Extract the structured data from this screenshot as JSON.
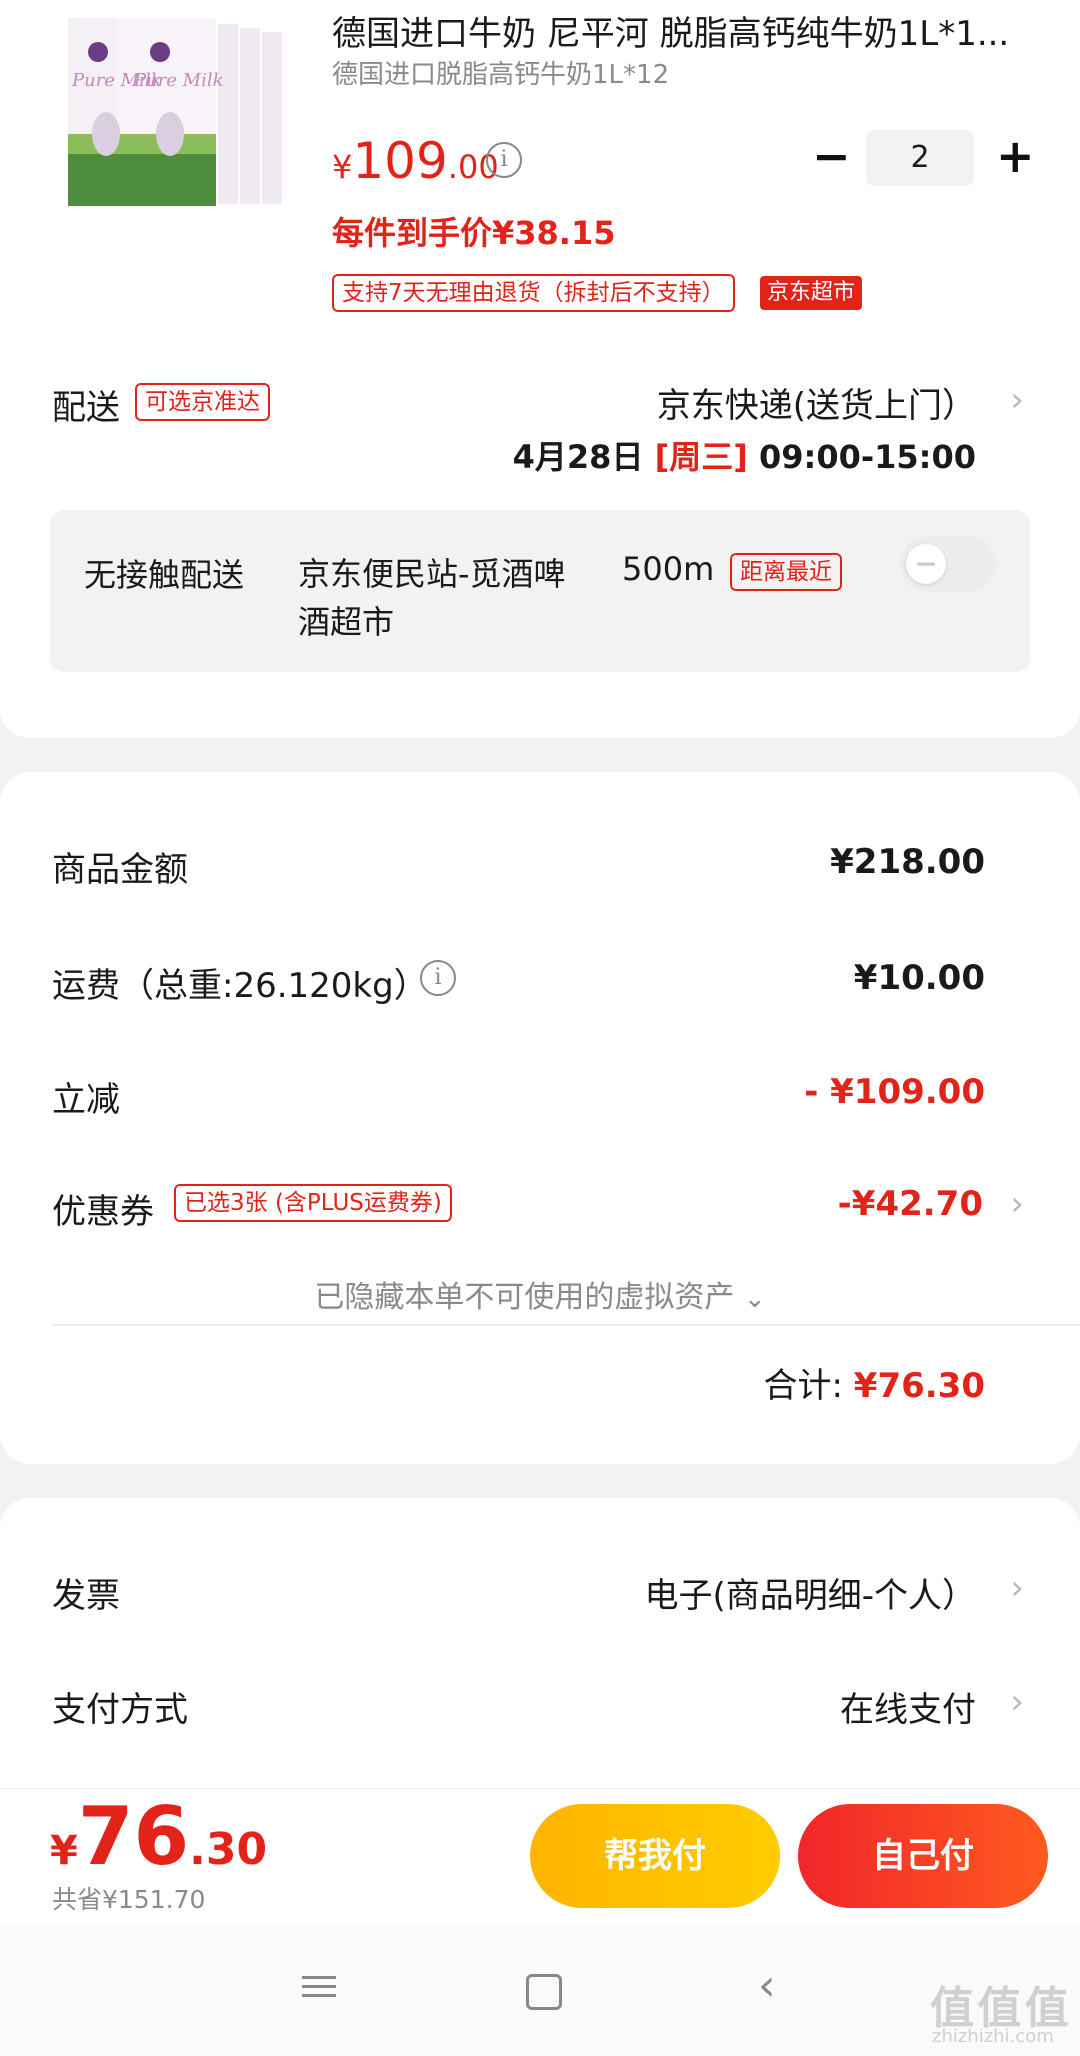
{
  "product": {
    "image_label": "Pure Milk",
    "title": "德国进口牛奶 尼平河 脱脂高钙纯牛奶1L*1...",
    "subtitle": "德国进口脱脂高钙牛奶1L*12",
    "price_symbol": "¥",
    "price_int": "109",
    "price_dec": ".00",
    "quantity": "2",
    "minus": "−",
    "plus": "+",
    "unit_price": "每件到手价¥38.15",
    "return_policy": "支持7天无理由退货（拆封后不支持）",
    "store_badge": "京东超市"
  },
  "delivery": {
    "label": "配送",
    "tag": "可选京准达",
    "method": "京东快递(送货上门）",
    "date": "4月28日",
    "weekday": "[周三]",
    "time": "09:00-15:00",
    "contactless_label": "无接触配送",
    "station": "京东便民站-觅酒啤酒超市",
    "distance": "500m",
    "distance_tag": "距离最近"
  },
  "summary": {
    "goods_label": "商品金额",
    "goods_value": "¥218.00",
    "shipping_label": "运费（总重:26.120kg）",
    "shipping_value": "¥10.00",
    "discount_label": "立减",
    "discount_value": "- ¥109.00",
    "coupon_label": "优惠券",
    "coupon_tag": "已选3张 (含PLUS运费券)",
    "coupon_value": "-¥42.70",
    "hidden_assets": "已隐藏本单不可使用的虚拟资产",
    "total_label": "合计:",
    "total_value": "¥76.30"
  },
  "options": {
    "invoice_label": "发票",
    "invoice_value": "电子(商品明细-个人）",
    "payment_label": "支付方式",
    "payment_value": "在线支付"
  },
  "checkout": {
    "symbol": "¥",
    "amount_int": "76",
    "amount_dec": ".30",
    "saved": "共省¥151.70",
    "help_pay": "帮我付",
    "self_pay": "自己付"
  },
  "watermark": {
    "text": "值 值 值",
    "site": "zhizhizhi.com"
  },
  "colors": {
    "accent_red": "#e2231a",
    "help_pay_gradient": [
      "#ffb400",
      "#ffcc00"
    ],
    "self_pay_gradient": [
      "#f1262b",
      "#ff5a1f"
    ]
  }
}
